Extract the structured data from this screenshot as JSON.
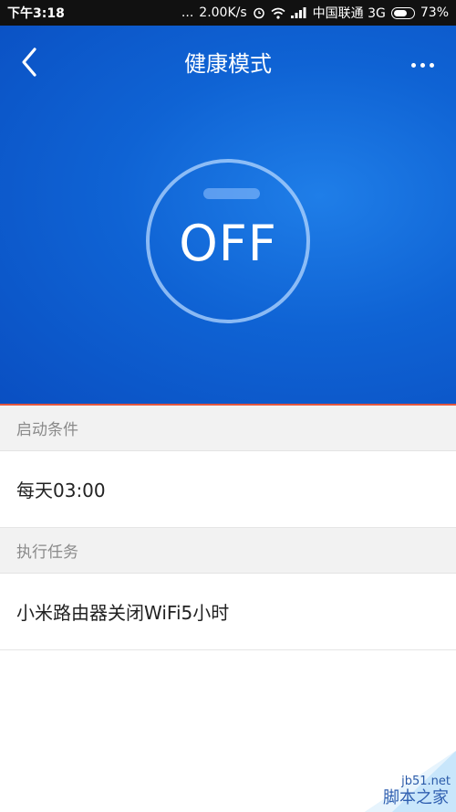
{
  "status_bar": {
    "time": "下午3:18",
    "dots": "...",
    "speed": "2.00K/s",
    "carrier": "中国联通 3G",
    "battery": "73%",
    "icons": [
      "alarm-icon",
      "wifi-icon",
      "signal-icon",
      "battery-icon"
    ]
  },
  "header": {
    "title": "健康模式",
    "back_icon": "back-chevron-icon",
    "more_icon": "more-dots-icon"
  },
  "power": {
    "label": "OFF"
  },
  "sections": {
    "start_condition": {
      "header": "启动条件",
      "value": "每天03:00"
    },
    "task": {
      "header": "执行任务",
      "value": "小米路由器关闭WiFi5小时"
    }
  },
  "watermark": {
    "site": "jb51.net",
    "name": "脚本之家"
  },
  "colors": {
    "accent_blue": "#0f63d4",
    "divider_red": "#e2573f",
    "section_bg": "#f2f2f2"
  }
}
